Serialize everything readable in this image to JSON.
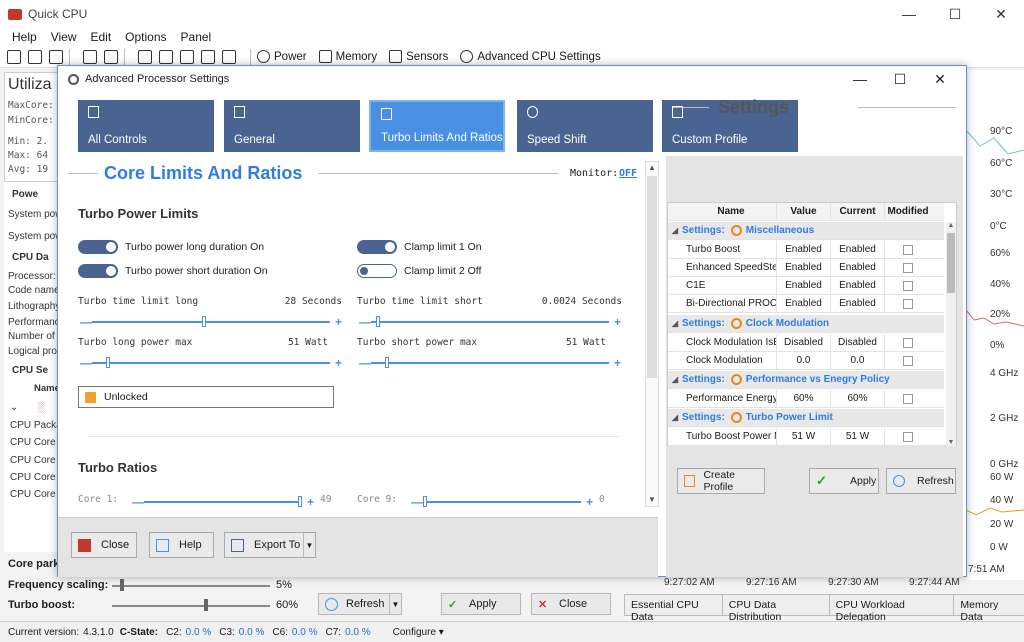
{
  "main": {
    "title": "Quick CPU",
    "menu": [
      "Help",
      "View",
      "Edit",
      "Options",
      "Panel"
    ],
    "toolbar": {
      "power": "Power",
      "memory": "Memory",
      "sensors": "Sensors",
      "advanced": "Advanced CPU Settings"
    },
    "left": {
      "utilization_title": "Utiliza",
      "maxcore": "MaxCore:",
      "mincore": "MinCore:",
      "min": "Min:  2.",
      "max": "Max:  64",
      "avg": "Avg:  19",
      "power_hdr": "Powe",
      "system_pow1": "System pow",
      "system_pow2": "System pow",
      "cpu_data_hdr": "CPU Da",
      "processor": "Processor:",
      "code_name": "Code name:",
      "lithography": "Lithography",
      "performance": "Performanc",
      "number_of": "Number of c",
      "logical_pro": "Logical pro",
      "cpu_sensors_hdr": "CPU Se",
      "name_col": "Name",
      "cpu_package": "CPU Packag",
      "cpu_core_1": "CPU Core 1",
      "cpu_core_2": "CPU Core 2",
      "cpu_core_3": "CPU Core 3",
      "cpu_core_4": "CPU Core 4"
    },
    "right_axis": [
      "90°C",
      "60°C",
      "30°C",
      "0°C",
      "60%",
      "40%",
      "20%",
      "0%",
      "4 GHz",
      "2 GHz",
      "0 GHz",
      "60 W",
      "40 W",
      "20 W",
      "0 W",
      "7:51 AM"
    ],
    "times": [
      "9:27:02 AM",
      "9:27:16 AM",
      "9:27:30 AM",
      "9:27:44 AM"
    ],
    "bottom": {
      "core_parking": "Core park",
      "freq_scaling_label": "Frequency scaling:",
      "freq_scaling_value": "5%",
      "freq_scaling_level": 0.05,
      "turbo_boost_label": "Turbo boost:",
      "turbo_boost_value": "60%",
      "turbo_boost_level": 0.6,
      "refresh": "Refresh",
      "apply": "Apply",
      "close": "Close"
    },
    "tabs": [
      "Essential CPU Data",
      "CPU Data Distribution",
      "CPU Workload Delegation",
      "Memory Data"
    ],
    "status": {
      "version_label": "Current version:",
      "version": "4.3.1.0",
      "cstate": "C-State:",
      "c2_label": "C2:",
      "c2": "0.0 %",
      "c3_label": "C3:",
      "c3": "0.0 %",
      "c6_label": "C6:",
      "c6": "0.0 %",
      "c7_label": "C7:",
      "c7": "0.0 %",
      "configure": "Configure"
    }
  },
  "dialog": {
    "title": "Advanced Processor Settings",
    "nav": [
      "All Controls",
      "General",
      "Turbo Limits And Ratios",
      "Speed Shift",
      "Custom Profile"
    ],
    "active_nav": "Turbo Limits And Ratios",
    "section_title": "Core Limits And Ratios",
    "monitor_label": "Monitor:",
    "monitor_value": "OFF",
    "turbo_power_limits": "Turbo Power Limits",
    "toggles": {
      "long_duration": {
        "label": "Turbo power long duration On",
        "on": true
      },
      "short_duration": {
        "label": "Turbo power short duration On",
        "on": true
      },
      "clamp1": {
        "label": "Clamp limit 1 On",
        "on": true
      },
      "clamp2": {
        "label": "Clamp limit 2 Off",
        "on": false
      }
    },
    "params": {
      "time_long_label": "Turbo time limit long",
      "time_long_value": "28 Seconds",
      "time_long_level": 0.47,
      "time_short_label": "Turbo time limit short",
      "time_short_value": "0.0024 Seconds",
      "time_short_level": 0.02,
      "power_long_label": "Turbo long power max",
      "power_long_value": "51 Watt",
      "power_long_level": 0.06,
      "power_short_label": "Turbo short power max",
      "power_short_value": "51 Watt",
      "power_short_level": 0.06
    },
    "unlocked": "Unlocked",
    "turbo_ratios": "Turbo Ratios",
    "core1_label": "Core 1:",
    "core1_value": "49",
    "core1_level": 1.0,
    "core9_label": "Core 9:",
    "core9_value": "0",
    "core9_level": 0.0,
    "buttons": {
      "close": "Close",
      "help": "Help",
      "export": "Export To"
    },
    "settings": {
      "title": "Settings",
      "columns": [
        "Name",
        "Value",
        "Current",
        "Modified"
      ],
      "groups": [
        {
          "label": "Settings:",
          "name": "Miscellaneous",
          "rows": [
            [
              "Turbo Boost",
              "Enabled",
              "Enabled"
            ],
            [
              "Enhanced SpeedStep",
              "Enabled",
              "Enabled"
            ],
            [
              "C1E",
              "Enabled",
              "Enabled"
            ],
            [
              "Bi-Directional PROCHOT",
              "Enabled",
              "Enabled"
            ]
          ]
        },
        {
          "label": "Settings:",
          "name": "Clock Modulation",
          "rows": [
            [
              "Clock Modulation IsEna...",
              "Disabled",
              "Disabled"
            ],
            [
              "Clock Modulation",
              "0.0",
              "0.0"
            ]
          ]
        },
        {
          "label": "Settings:",
          "name": "Performance vs Enegry Policy",
          "rows": [
            [
              "Performance Energy Po...",
              "60%",
              "60%"
            ]
          ]
        },
        {
          "label": "Settings:",
          "name": "Turbo Power Limit",
          "rows": [
            [
              "Turbo Boost Power Ma...",
              "51 W",
              "51 W"
            ]
          ]
        }
      ],
      "create_profile": "Create Profile",
      "apply": "Apply",
      "refresh": "Refresh"
    }
  }
}
